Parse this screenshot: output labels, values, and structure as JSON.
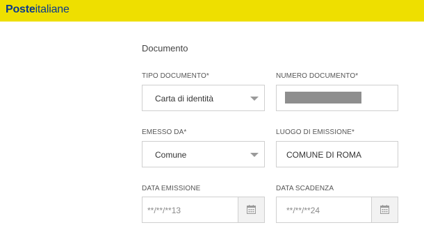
{
  "brand": {
    "bold": "Poste",
    "light": "italiane"
  },
  "section_title": "Documento",
  "fields": {
    "tipo_documento": {
      "label": "TIPO DOCUMENTO*",
      "value": "Carta di identità"
    },
    "numero_documento": {
      "label": "NUMERO DOCUMENTO*",
      "value": ""
    },
    "emesso_da": {
      "label": "EMESSO DA*",
      "value": "Comune"
    },
    "luogo_emissione": {
      "label": "LUOGO DI EMISSIONE*",
      "value": "COMUNE DI ROMA"
    },
    "data_emissione": {
      "label": "DATA EMISSIONE",
      "value": "**/**/**13"
    },
    "data_scadenza": {
      "label": "DATA SCADENZA",
      "value": "**/**/**24"
    }
  },
  "colors": {
    "header": "#eedf00",
    "brand": "#0a3a8c",
    "border": "#cfcfcf"
  },
  "icons": {
    "dropdown": "chevron-down-icon",
    "calendar": "calendar-icon"
  }
}
